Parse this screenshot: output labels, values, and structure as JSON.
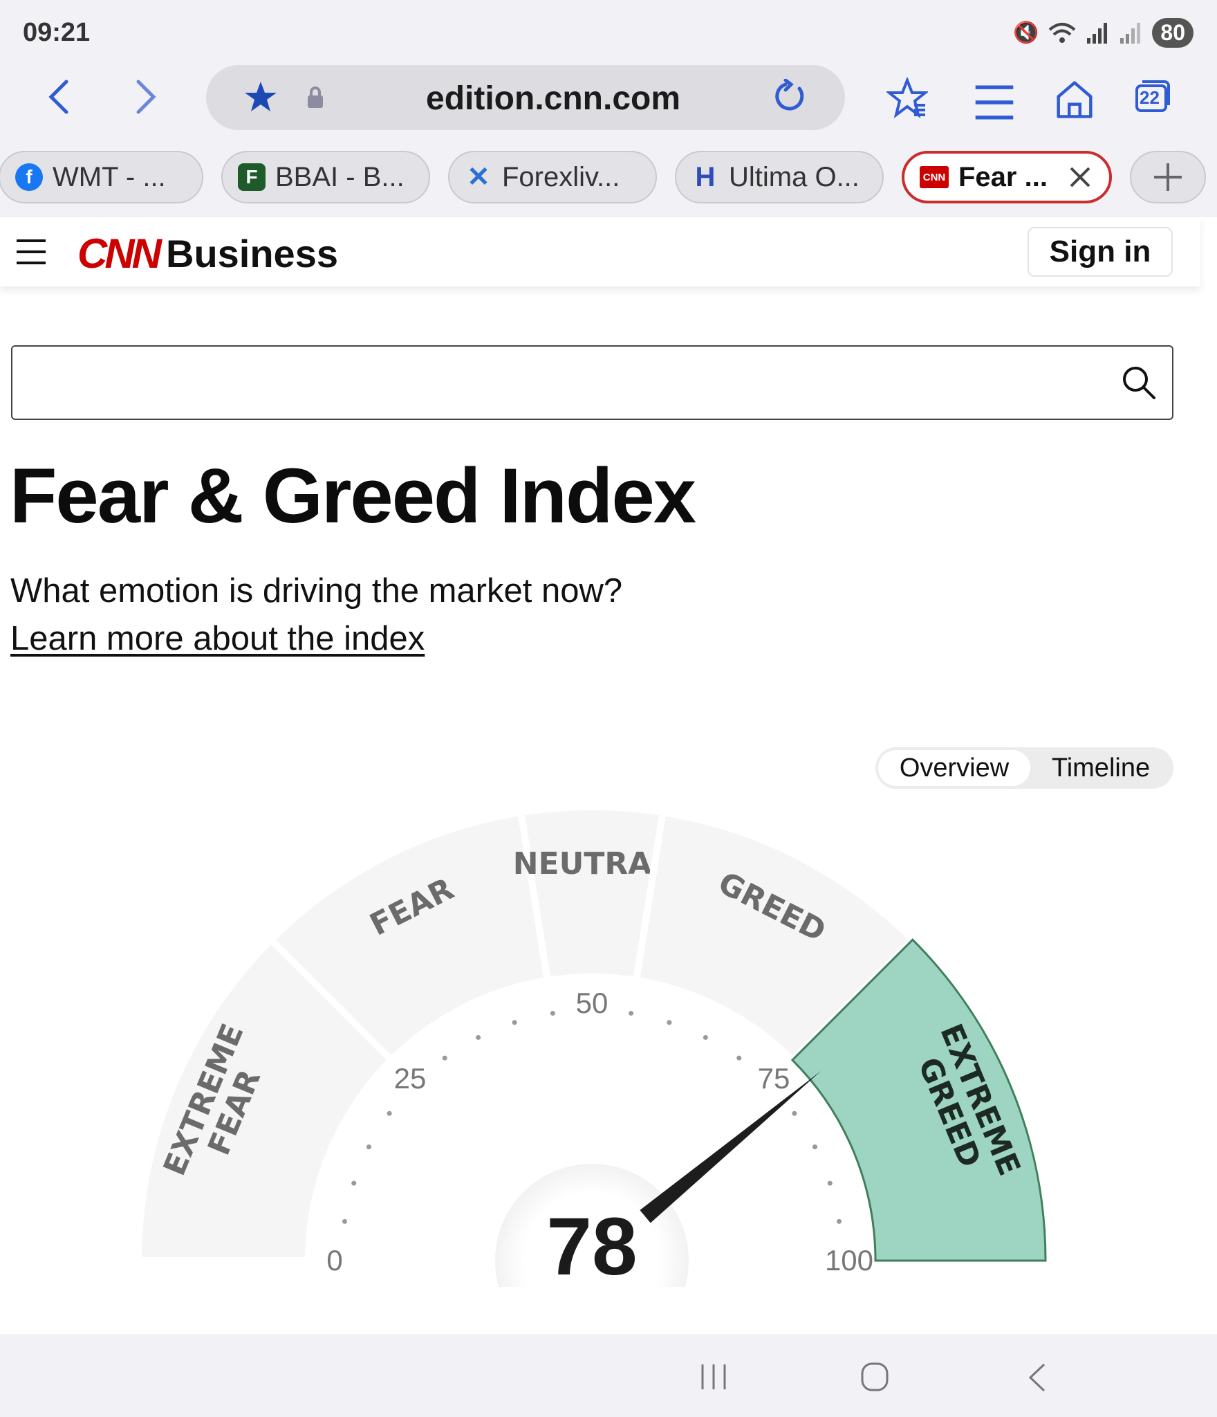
{
  "status_bar": {
    "time": "09:21",
    "battery": "80"
  },
  "browser": {
    "url": "edition.cnn.com",
    "tabs_count": "22",
    "tabs": [
      {
        "label": "WMT - ...",
        "favicon_color": "#1877f2",
        "favicon_letter": "f"
      },
      {
        "label": "BBAI - B...",
        "favicon_color": "#1f5b2a",
        "favicon_letter": "F"
      },
      {
        "label": "Forexliv...",
        "favicon_color": "#ffffff",
        "favicon_letter": "X"
      },
      {
        "label": "Ultima O...",
        "favicon_color": "#ffffff",
        "favicon_letter": "H"
      },
      {
        "label": "Fear ...",
        "favicon_color": "#cc0000",
        "favicon_letter": "CNN"
      }
    ]
  },
  "header": {
    "logo": "CNN",
    "section": "Business",
    "signin_label": "Sign in"
  },
  "search": {
    "placeholder": ""
  },
  "page": {
    "title": "Fear & Greed Index",
    "subtitle": "What emotion is driving the market now?",
    "learn_link": "Learn more about the index"
  },
  "toggle": {
    "overview": "Overview",
    "timeline": "Timeline"
  },
  "gauge": {
    "value": 78,
    "active_segment": "EXTREME GREED",
    "accent": "#9ed5c2",
    "accent_border": "#3f7f5a",
    "segments": [
      {
        "label_lines": [
          "EXTREME",
          "FEAR"
        ],
        "from": 0,
        "to": 25
      },
      {
        "label_lines": [
          "FEAR"
        ],
        "from": 25,
        "to": 45
      },
      {
        "label_lines": [
          "NEUTRAL"
        ],
        "from": 45,
        "to": 55
      },
      {
        "label_lines": [
          "GREED"
        ],
        "from": 55,
        "to": 75
      },
      {
        "label_lines": [
          "EXTREME",
          "GREED"
        ],
        "from": 75,
        "to": 100
      }
    ],
    "ticks": [
      "0",
      "25",
      "50",
      "75",
      "100"
    ]
  }
}
